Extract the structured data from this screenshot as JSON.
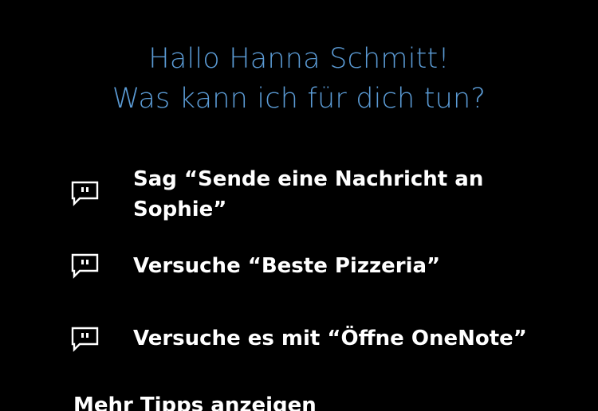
{
  "greeting": {
    "line1": "Hallo Hanna Schmitt!",
    "line2": "Was kann ich für dich tun?"
  },
  "tips": [
    {
      "text": "Sag “Sende eine Nachricht an Sophie”",
      "icon": "speech-bubble-icon"
    },
    {
      "text": "Versuche “Beste Pizzeria”",
      "icon": "speech-bubble-icon"
    },
    {
      "text": "Versuche es mit “Öffne OneNote”",
      "icon": "speech-bubble-icon"
    }
  ],
  "more_tips": "Mehr Tipps anzeigen",
  "colors": {
    "background": "#000000",
    "accent": "#5b9bd5",
    "text": "#ffffff"
  }
}
